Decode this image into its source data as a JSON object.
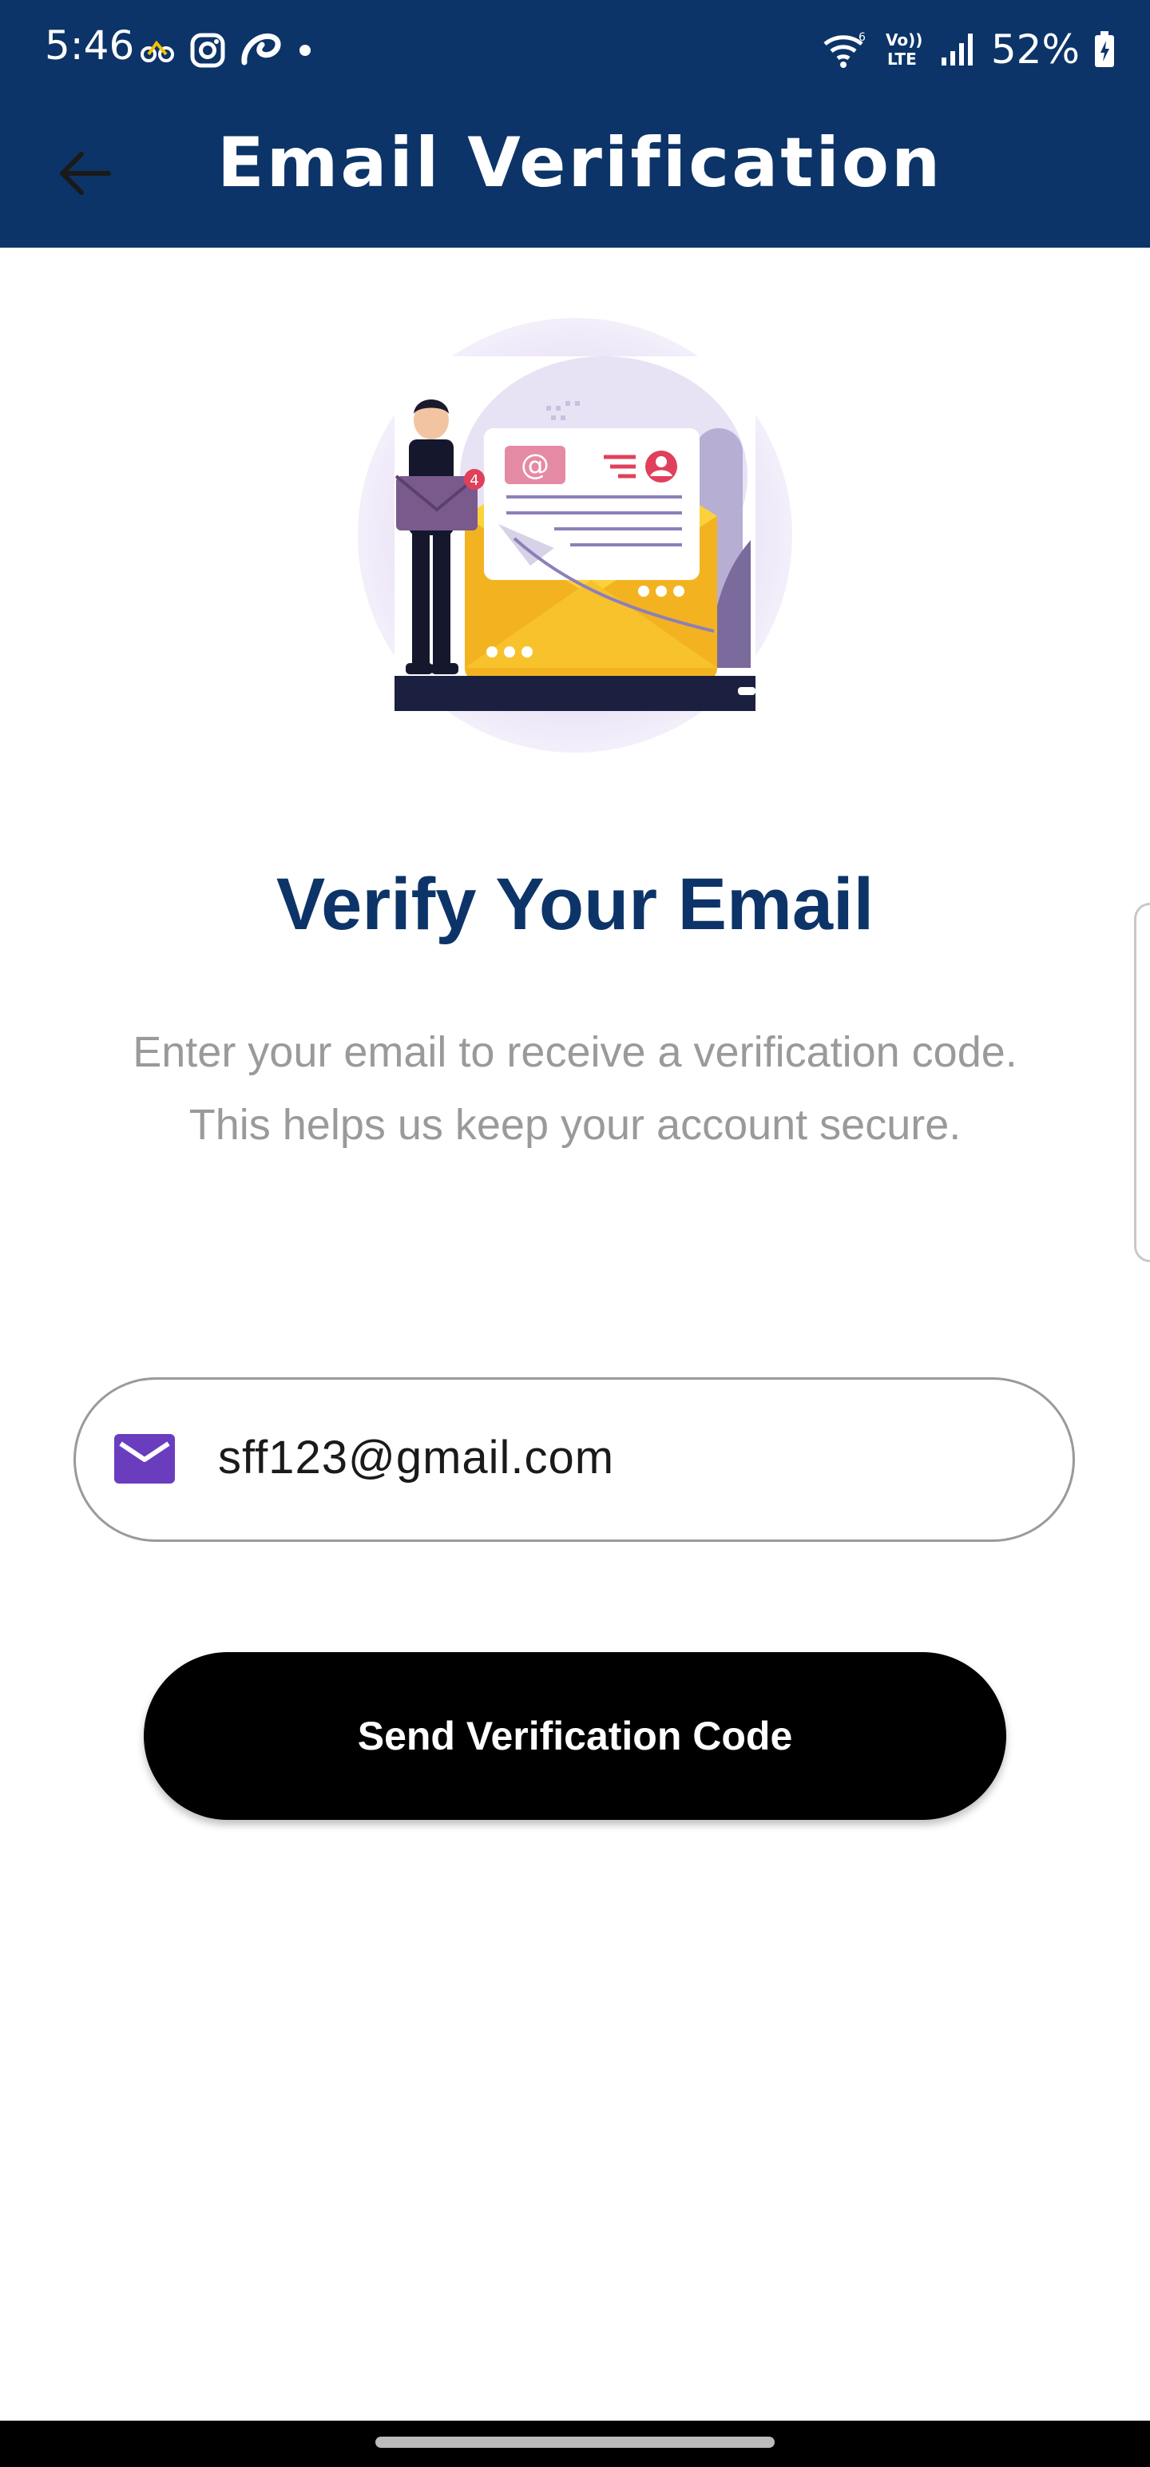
{
  "status_bar": {
    "time": "5:46",
    "battery": "52%",
    "network": "VoLTE",
    "icons_left": [
      "notification-icon",
      "instagram-icon",
      "airtel-icon",
      "dot-icon"
    ],
    "icons_right": [
      "wifi-icon",
      "volte-icon",
      "signal-icon",
      "battery-icon"
    ]
  },
  "app_bar": {
    "title": "Email Verification",
    "back_icon": "arrow-left-icon",
    "color": "#0c3468"
  },
  "main": {
    "illustration": "email-verification-illustration",
    "heading": "Verify Your Email",
    "description": "Enter your email to receive a verification code. This helps us keep your account secure.",
    "email_field": {
      "icon": "mail-icon",
      "value": "sff123@gmail.com",
      "icon_color": "#6a3dbf"
    },
    "send_button": {
      "label": "Send Verification Code",
      "color": "#000000"
    }
  },
  "illustration_text": {
    "badge_count": "4",
    "at_symbol": "@"
  }
}
